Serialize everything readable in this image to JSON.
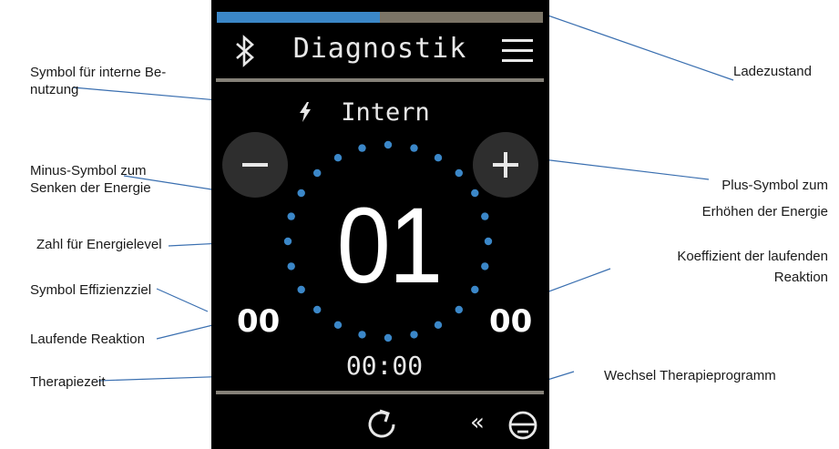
{
  "device": {
    "battery_level": 0.5,
    "title": "Diagnostik",
    "mode_icon": "lightning-icon",
    "mode_label": "Intern",
    "energy_level": "01",
    "left_value": "00",
    "right_value": "00",
    "therapy_time": "00:00",
    "accent_color": "#3b87c8",
    "double_chevron": "«",
    "icons": [
      "bluetooth-icon",
      "menu-icon",
      "minus-icon",
      "plus-icon",
      "refresh-icon",
      "program-switch-icon"
    ]
  },
  "labels": {
    "intern_symbol": [
      "Symbol für interne Be-",
      "nutzung"
    ],
    "minus_symbol": [
      "Minus-Symbol zum",
      "Senken der Energie"
    ],
    "energy_number": "Zahl für Energielevel",
    "efficiency_symbol": "Symbol Effizienzziel",
    "running_reaction": "Laufende Reaktion",
    "therapy_time": "Therapiezeit",
    "battery": "Ladezustand",
    "plus_symbol": [
      "Plus-Symbol zum",
      "Erhöhen der Energie"
    ],
    "coefficient": [
      "Koeffizient der laufenden",
      "Reaktion"
    ],
    "program_switch": "Wechsel Therapieprogramm"
  }
}
